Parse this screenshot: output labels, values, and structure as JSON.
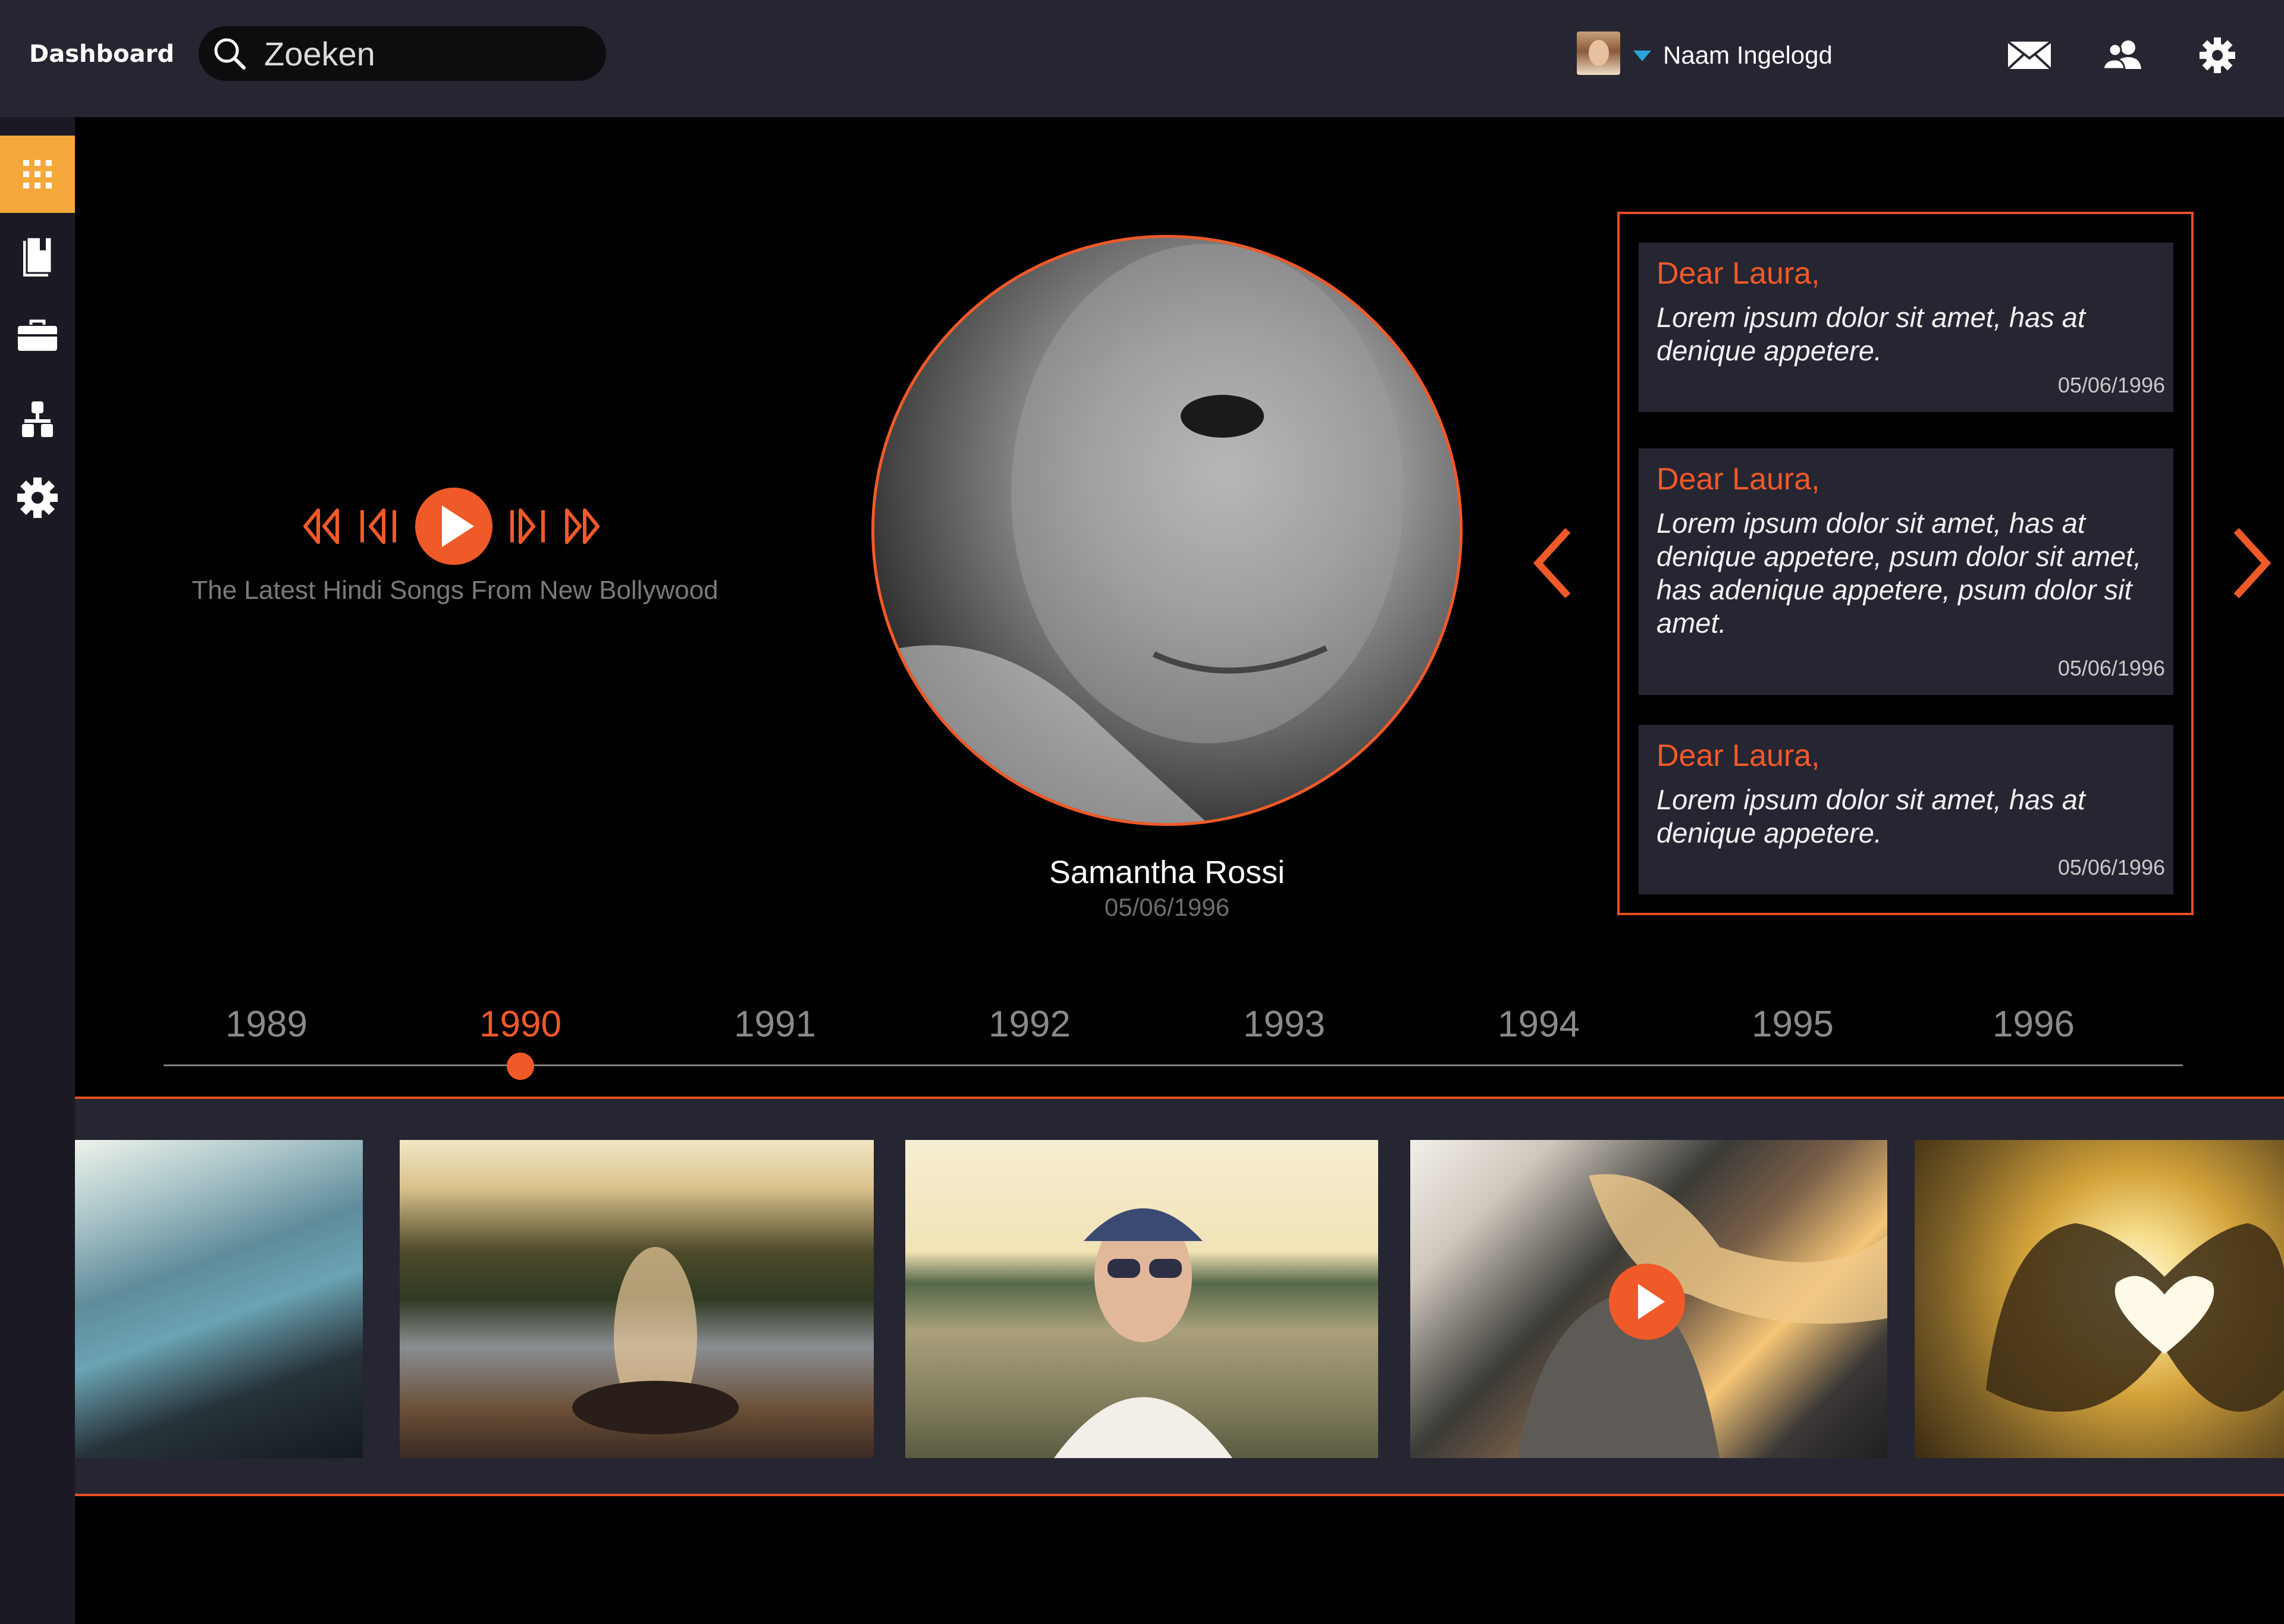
{
  "header": {
    "brand": "Dashboard",
    "search": {
      "placeholder": "Zoeken",
      "value": ""
    },
    "user": {
      "name": "Naam Ingelogd"
    },
    "icons": [
      "mail-icon",
      "users-icon",
      "settings-icon"
    ]
  },
  "sidebar": {
    "items": [
      {
        "icon": "grid-icon",
        "active": true
      },
      {
        "icon": "book-icon",
        "active": false
      },
      {
        "icon": "briefcase-icon",
        "active": false
      },
      {
        "icon": "org-chart-icon",
        "active": false
      },
      {
        "icon": "gear-icon",
        "active": false
      }
    ]
  },
  "player": {
    "caption": "The Latest Hindi Songs From New Bollywood",
    "controls": [
      "rewind-icon",
      "previous-icon",
      "play-icon",
      "next-icon",
      "fast-forward-icon"
    ]
  },
  "profile": {
    "name": "Samantha Rossi",
    "date": "05/06/1996"
  },
  "messages": [
    {
      "greeting": "Dear Laura,",
      "body": "Lorem ipsum dolor sit amet, has at denique appetere.",
      "date": "05/06/1996"
    },
    {
      "greeting": "Dear Laura,",
      "body": "Lorem ipsum dolor sit amet, has at denique appetere, psum dolor sit amet, has adenique appetere, psum dolor sit amet.",
      "date": "05/06/1996"
    },
    {
      "greeting": "Dear Laura,",
      "body": "Lorem ipsum dolor sit amet, has at denique appetere.",
      "date": "05/06/1996"
    }
  ],
  "timeline": {
    "years": [
      "1989",
      "1990",
      "1991",
      "1992",
      "1993",
      "1994",
      "1995",
      "1996"
    ],
    "selected": "1990"
  },
  "gallery": {
    "photos": [
      "fjord",
      "woman-sitting-sunset",
      "woman-sunglasses-flowers",
      "woman-hair-wind-video",
      "heart-hands-sunset"
    ]
  },
  "colors": {
    "accent": "#f05a28",
    "sidebar_active": "#f6a93a",
    "panel": "#262532",
    "topbar": "#262532",
    "caret": "#2aa3dc"
  }
}
